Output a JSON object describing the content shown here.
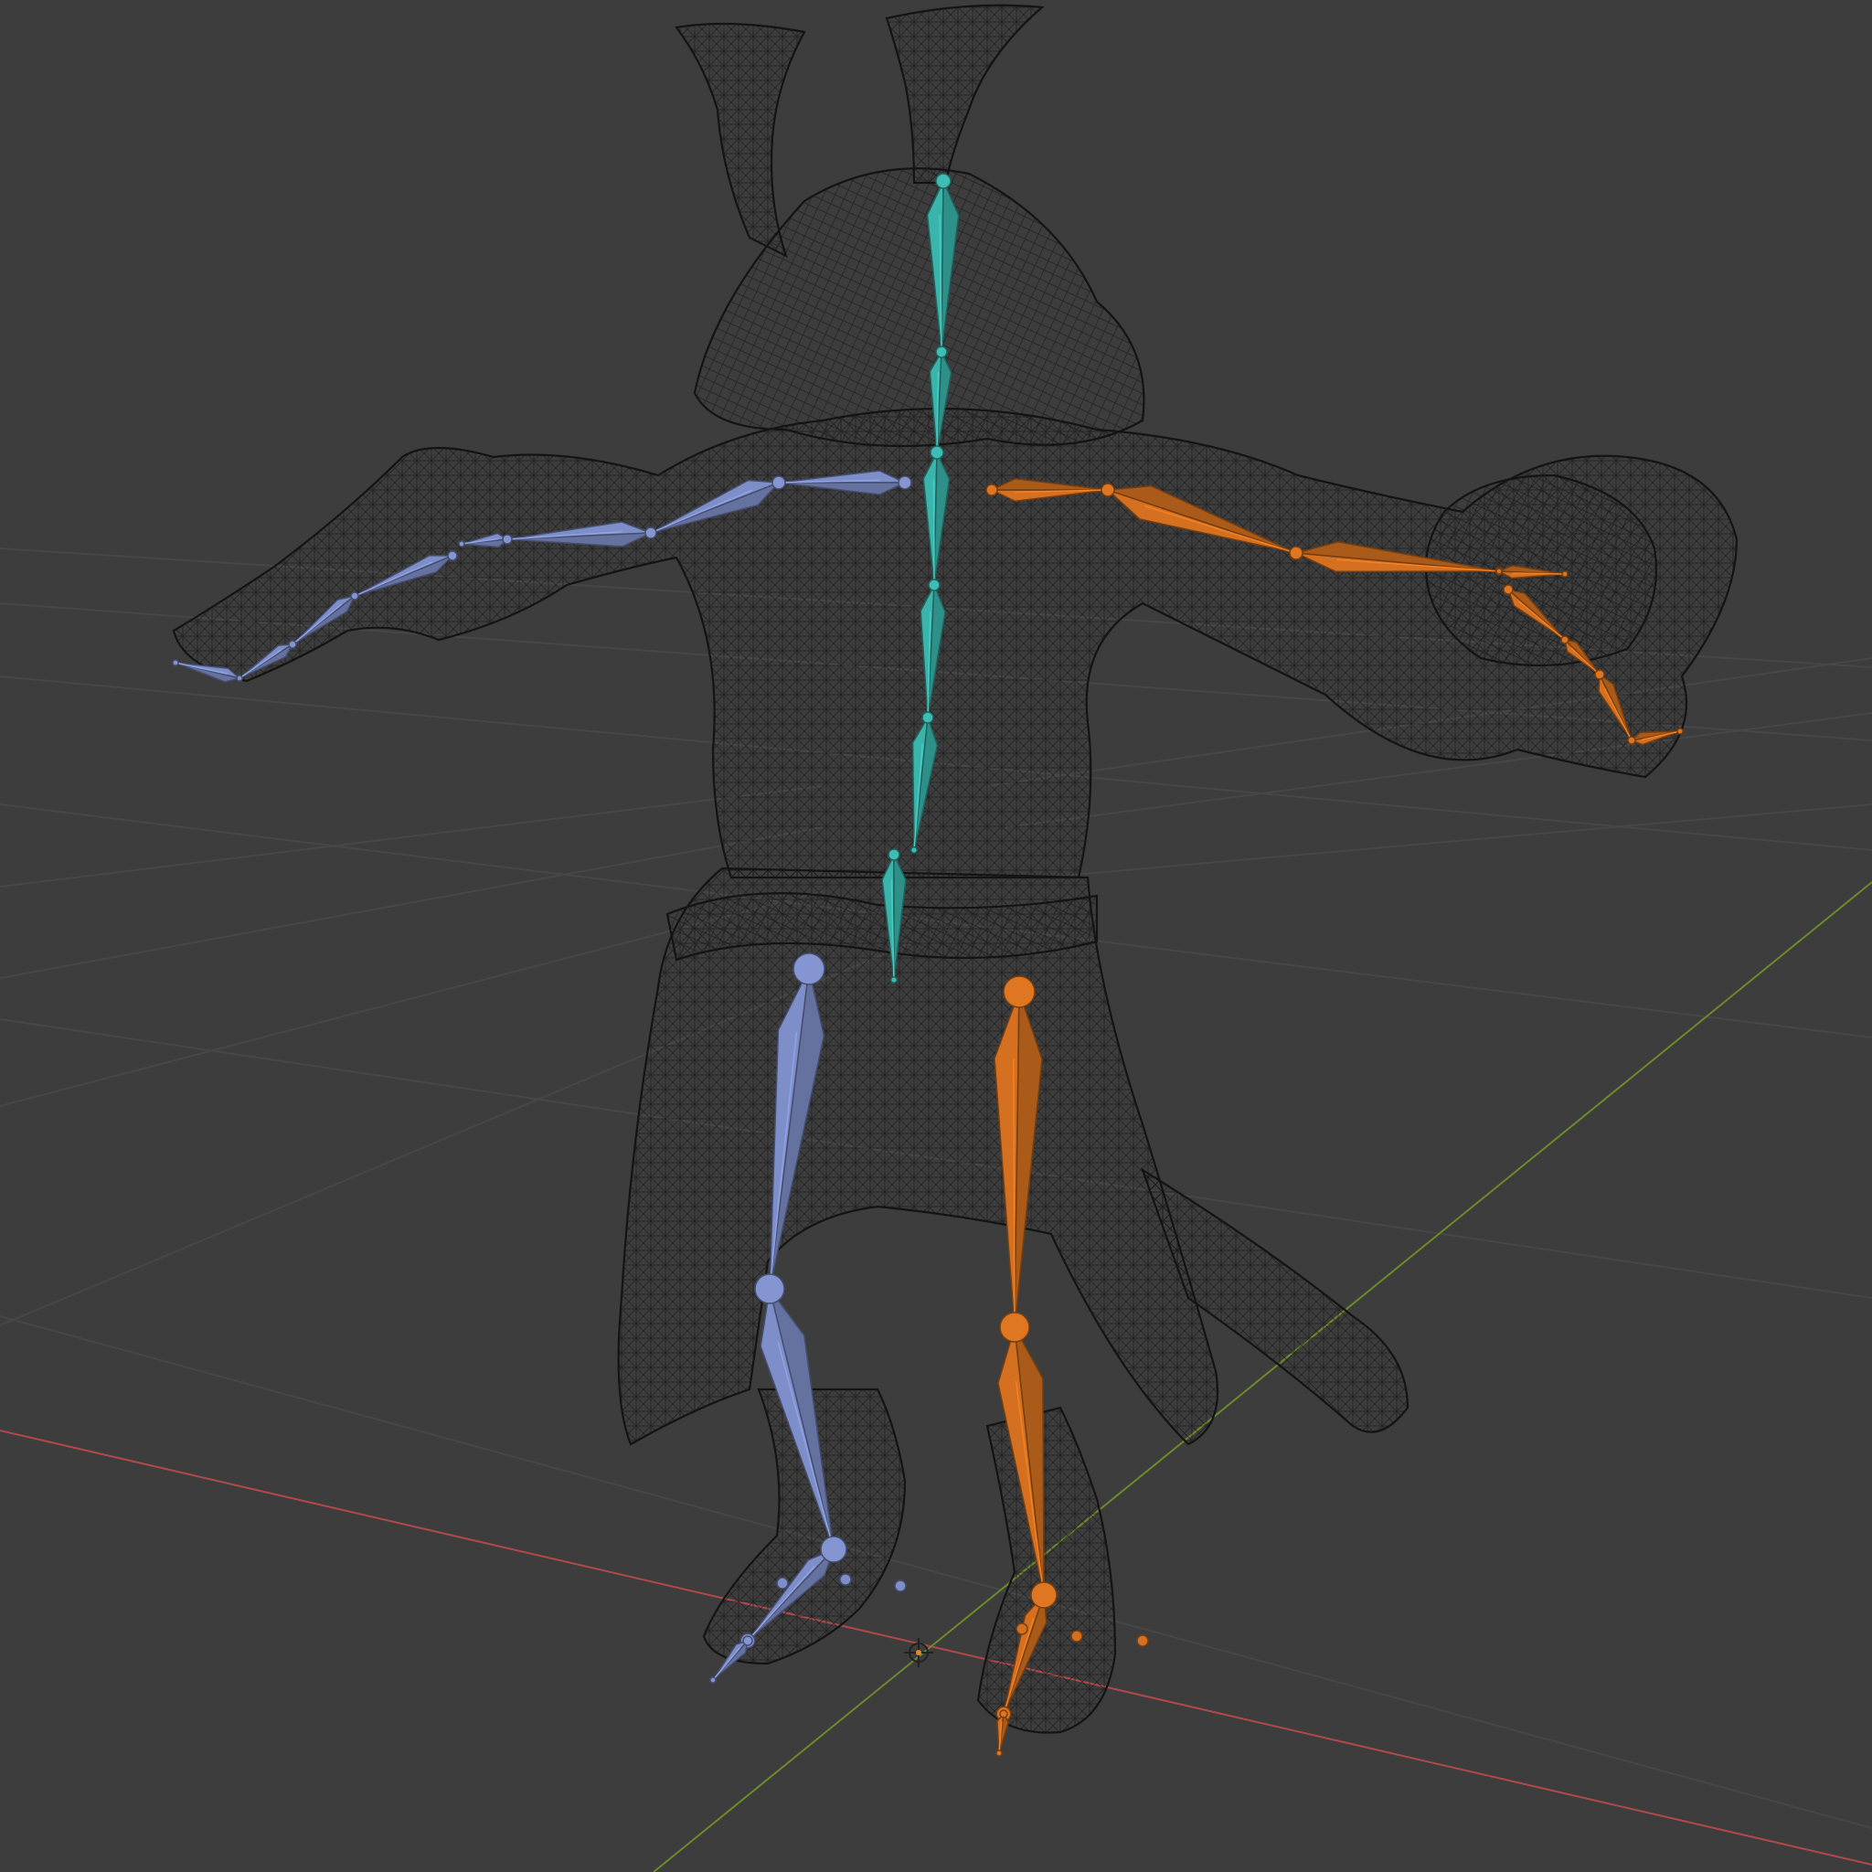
{
  "viewport": {
    "mode": "armature-wireframe",
    "background": "#3d3d3d"
  },
  "axes": {
    "x_axis_color": "#b04a4a",
    "y_axis_color": "#6b8a2a"
  },
  "mesh": {
    "wire_color": "#141414"
  },
  "bones": {
    "center_color": "#3bb4ab",
    "left_color": "#7e8ec8",
    "right_color": "#d4701f"
  },
  "icons": {
    "origin": "origin-crosshair-icon"
  }
}
